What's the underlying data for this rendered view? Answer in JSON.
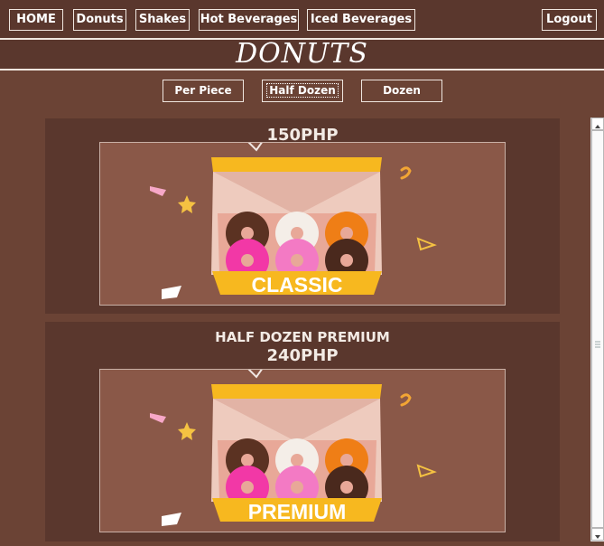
{
  "nav": {
    "home": "HOME",
    "donuts": "Donuts",
    "shakes": "Shakes",
    "hot_beverages": "Hot Beverages",
    "iced_beverages": "Iced Beverages",
    "logout": "Logout"
  },
  "page": {
    "title": "DONUTS"
  },
  "subnav": {
    "per_piece": "Per Piece",
    "half_dozen": "Half Dozen",
    "dozen": "Dozen"
  },
  "products": [
    {
      "name": "",
      "price": "150PHP",
      "box_label": "CLASSIC"
    },
    {
      "name": "HALF DOZEN PREMIUM",
      "price": "240PHP",
      "box_label": "PREMIUM"
    }
  ],
  "colors": {
    "background": "#6b4335",
    "panel": "#5a372d",
    "image_bg": "#8a5848",
    "box_yellow": "#f7b81f"
  }
}
